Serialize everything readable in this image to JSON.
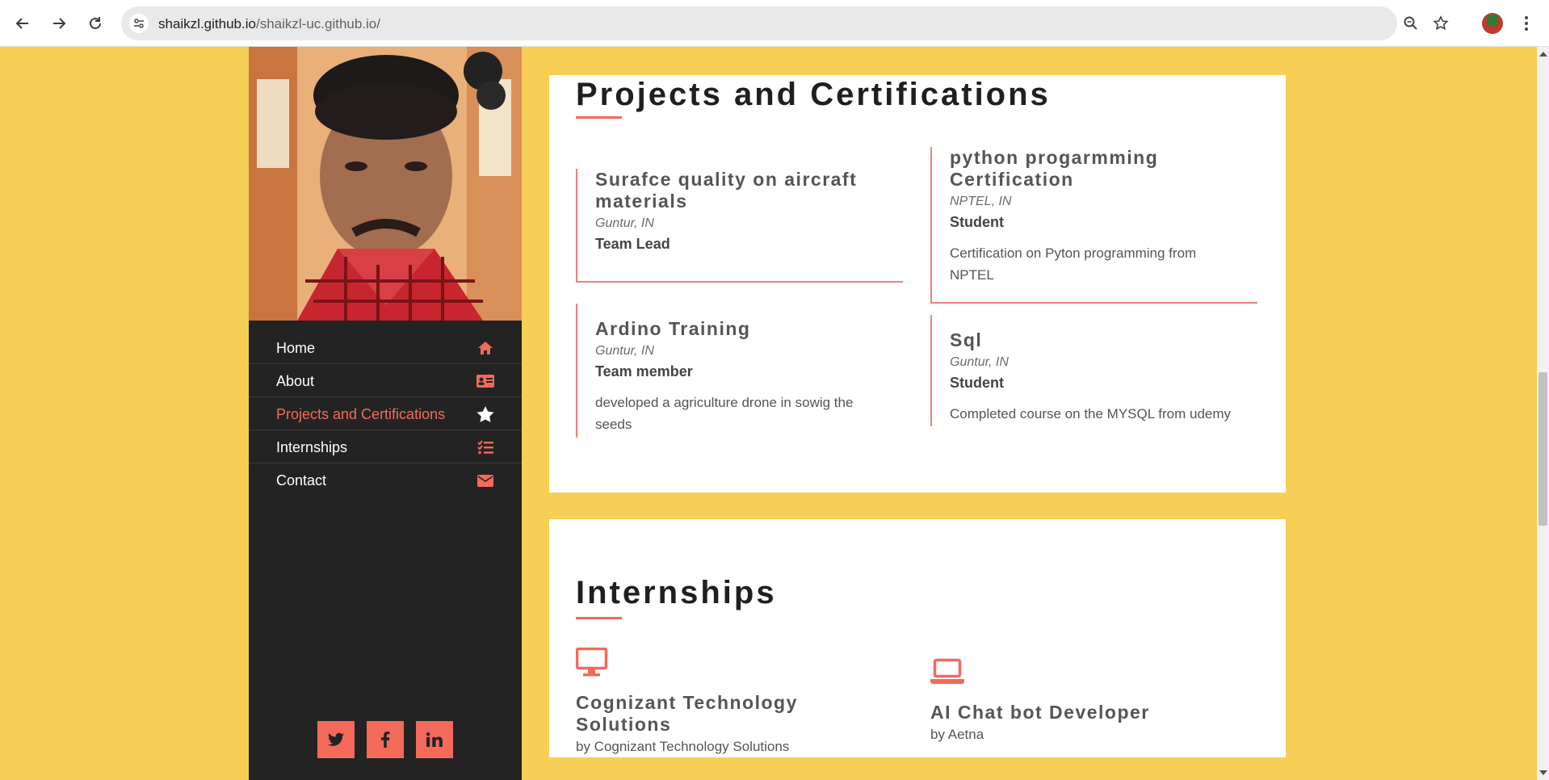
{
  "browser": {
    "url_host": "shaikzl.github.io",
    "url_path": "/shaikzl-uc.github.io/",
    "icons": [
      "back-icon",
      "forward-icon",
      "reload-icon",
      "site-settings-icon",
      "zoom-icon",
      "bookmark-star-icon",
      "profile-avatar",
      "more-menu-icon"
    ]
  },
  "sidebar": {
    "nav": [
      {
        "label": "Home",
        "icon": "home-icon"
      },
      {
        "label": "About",
        "icon": "id-card-icon"
      },
      {
        "label": "Projects and Certifications",
        "icon": "star-icon",
        "active": true
      },
      {
        "label": "Internships",
        "icon": "tasks-list-icon"
      },
      {
        "label": "Contact",
        "icon": "envelope-icon"
      }
    ],
    "social": [
      {
        "glyph": "t",
        "icon": "twitter-icon"
      },
      {
        "glyph": "f",
        "icon": "facebook-icon"
      },
      {
        "glyph": "in",
        "icon": "linkedin-icon"
      }
    ]
  },
  "projects": {
    "title": "Projects and Certifications",
    "items": [
      {
        "title": "Surafce quality on aircraft materials",
        "place": "Guntur, IN",
        "role": "Team Lead",
        "desc": ""
      },
      {
        "title": "python progarmming Certification",
        "place": "NPTEL, IN",
        "role": "Student",
        "desc": "Certification on Pyton programming from NPTEL"
      },
      {
        "title": "Ardino Training",
        "place": "Guntur, IN",
        "role": "Team member",
        "desc": "developed a agriculture drone in sowig the seeds"
      },
      {
        "title": "Sql",
        "place": "Guntur, IN",
        "role": "Student",
        "desc": "Completed course on the MYSQL from udemy"
      }
    ]
  },
  "internships": {
    "title": "Internships",
    "items": [
      {
        "title": "Cognizant Technology Solutions",
        "by": "by Cognizant Technology Solutions",
        "icon": "desktop-icon"
      },
      {
        "title": "AI Chat bot Developer",
        "by": "by Aetna",
        "icon": "laptop-icon"
      }
    ]
  },
  "colors": {
    "accent": "#f46a5a",
    "background": "#f7cf55",
    "sidebar": "#232323"
  }
}
